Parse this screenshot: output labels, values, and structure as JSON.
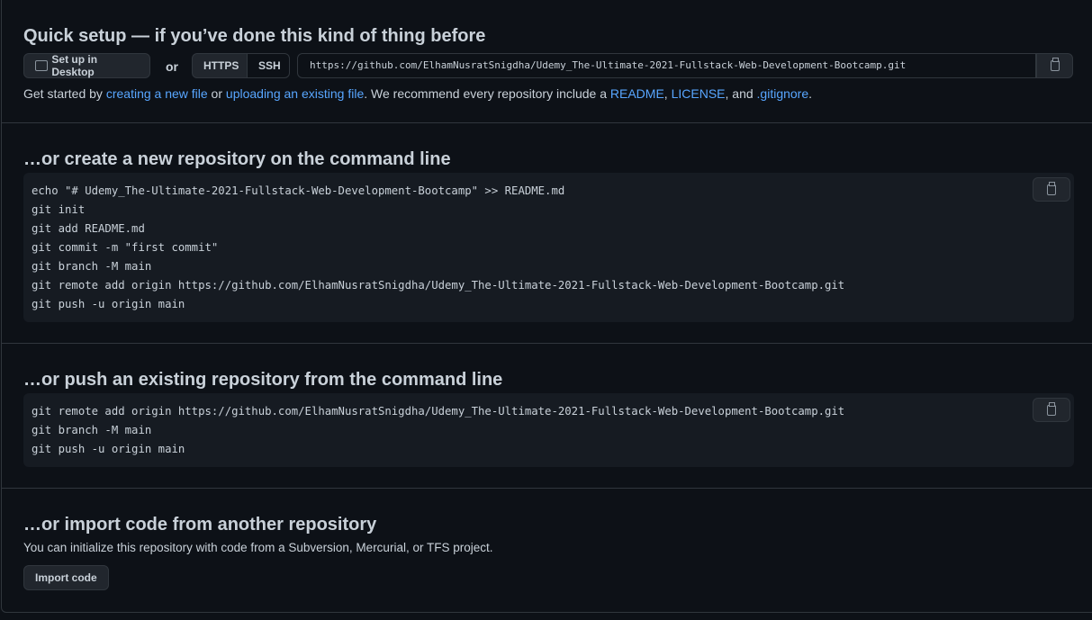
{
  "quick": {
    "title": "Quick setup — if you’ve done this kind of thing before",
    "desktop": "Set up in Desktop",
    "or": "or",
    "https": "HTTPS",
    "ssh": "SSH",
    "url": "https://github.com/ElhamNusratSnigdha/Udemy_The-Ultimate-2021-Fullstack-Web-Development-Bootcamp.git",
    "help": {
      "t1": "Get started by ",
      "l1": "creating a new file",
      "t2": " or ",
      "l2": "uploading an existing file",
      "t3": ". We recommend every repository include a ",
      "l3": "README",
      "t4": ", ",
      "l4": "LICENSE",
      "t5": ", and ",
      "l5": ".gitignore",
      "t6": "."
    }
  },
  "create": {
    "title": "…or create a new repository on the command line",
    "code": "echo \"# Udemy_The-Ultimate-2021-Fullstack-Web-Development-Bootcamp\" >> README.md\ngit init\ngit add README.md\ngit commit -m \"first commit\"\ngit branch -M main\ngit remote add origin https://github.com/ElhamNusratSnigdha/Udemy_The-Ultimate-2021-Fullstack-Web-Development-Bootcamp.git\ngit push -u origin main"
  },
  "push": {
    "title": "…or push an existing repository from the command line",
    "code": "git remote add origin https://github.com/ElhamNusratSnigdha/Udemy_The-Ultimate-2021-Fullstack-Web-Development-Bootcamp.git\ngit branch -M main\ngit push -u origin main"
  },
  "import": {
    "title": "…or import code from another repository",
    "desc": "You can initialize this repository with code from a Subversion, Mercurial, or TFS project.",
    "button": "Import code"
  }
}
